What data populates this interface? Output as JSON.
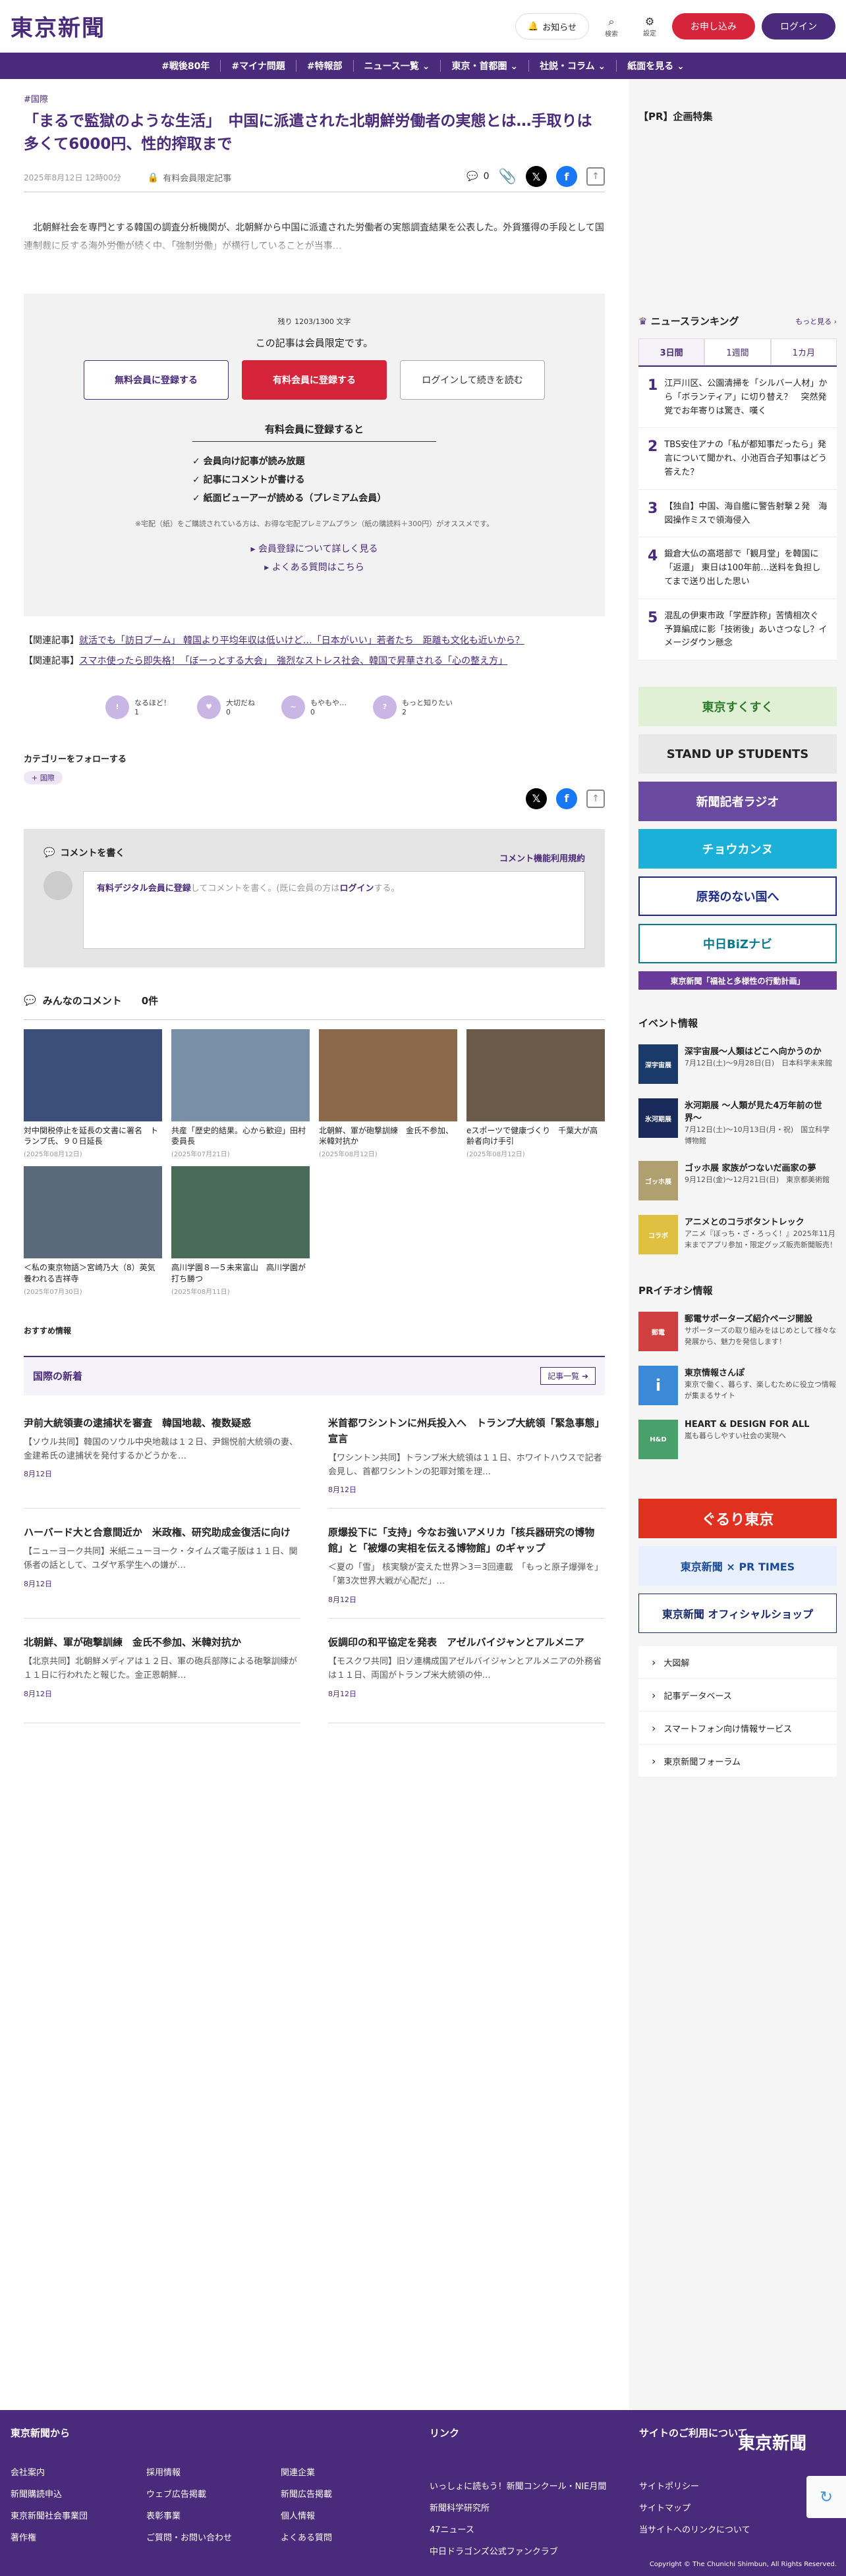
{
  "header": {
    "logo": "東京新聞",
    "notify": "お知らせ",
    "search": "検索",
    "settings": "設定",
    "apply": "お申し込み",
    "login": "ログイン"
  },
  "nav": [
    "#戦後80年",
    "#マイナ問題",
    "#特報部",
    "ニュース一覧 ⌄",
    "東京・首都圏 ⌄",
    "社説・コラム ⌄",
    "紙面を見る ⌄"
  ],
  "article": {
    "category": "#国際",
    "title": "「まるで監獄のような生活」　中国に派遣された北朝鮮労働者の実態とは…手取りは多くて6000円、性的搾取まで",
    "date": "2025年8月12日 12時00分",
    "members_only": "有料会員限定記事",
    "comment_count": "0",
    "lead": "　北朝鮮社会を専門とする韓国の調査分析機関が、北朝鮮から中国に派遣された労働者の実態調査結果を公表した。外貨獲得の手段として国連制裁に反する海外労働が続く中、「強制労働」が横行していることが当事…"
  },
  "paywall": {
    "remaining": "残り 1203/1300 文字",
    "members_only": "この記事は会員限定です。",
    "free_btn": "無料会員に登録する",
    "paid_btn": "有料会員に登録する",
    "login_btn": "ログインして続きを読む",
    "subhead": "有料会員に登録すると",
    "benefits": [
      "会員向け記事が読み放題",
      "記事にコメントが書ける",
      "紙面ビューアーが読める（プレミアム会員）"
    ],
    "note": "※宅配（紙）をご購読されている方は、お得な宅配プレミアムプラン（紙の購読料＋300円）がオススメです。",
    "link1": "会員登録について詳しく見る",
    "link2": "よくある質問はこちら"
  },
  "related": [
    {
      "prefix": "【関連記事】",
      "text": "就活でも「訪日ブーム」 韓国より平均年収は低いけど…「日本がいい」若者たち　距離も文化も近いから？"
    },
    {
      "prefix": "【関連記事】",
      "text": "スマホ使ったら即失格！「ぼーっとする大会」　強烈なストレス社会、韓国で昇華される「心の整え方」"
    }
  ],
  "reactions": [
    {
      "icon": "!",
      "label": "なるほど！",
      "count": "1",
      "color": "#c9b6e4"
    },
    {
      "icon": "♥",
      "label": "大切だね",
      "count": "0",
      "color": "#c9b6e4"
    },
    {
      "icon": "~",
      "label": "もやもや…",
      "count": "0",
      "color": "#c9b6e4"
    },
    {
      "icon": "?",
      "label": "もっと知りたい",
      "count": "2",
      "color": "#c9b6e4"
    }
  ],
  "follow": {
    "title": "カテゴリーをフォローする",
    "chip": "国際"
  },
  "comment_box": {
    "title": "コメントを書く",
    "rules": "コメント機能利用規約",
    "prompt_link": "有料デジタル会員に登録",
    "prompt_mid": "してコメントを書く。(既に会員の方は",
    "prompt_login": "ログイン",
    "prompt_end": "する。"
  },
  "all_comments": {
    "title": "みんなのコメント",
    "count": "0件"
  },
  "photos": [
    {
      "caption": "対中関税停止を延長の文書に署名　トランプ氏、９０日延長",
      "date": "(2025年08月12日)",
      "color": "#3b4f7a"
    },
    {
      "caption": "共産「歴史的結果。心から歓迎」田村委員長",
      "date": "(2025年07月21日)",
      "color": "#7a8fa8"
    },
    {
      "caption": "北朝鮮、軍が砲撃訓練　金氏不参加、米韓対抗か",
      "date": "(2025年08月12日)",
      "color": "#8a6a4a"
    },
    {
      "caption": "eスポーツで健康づくり　千葉大が高齢者向け手引",
      "date": "(2025年08月12日)",
      "color": "#6a5a4a"
    },
    {
      "caption": "＜私の東京物語＞宮崎乃大（8）英気養われる吉祥寺",
      "date": "(2025年07月30日)",
      "color": "#5a6a7a"
    },
    {
      "caption": "高川学園８―５未来富山　高川学園が打ち勝つ",
      "date": "(2025年08月11日)",
      "color": "#4a6a5a"
    }
  ],
  "recommend": "おすすめ情報",
  "intl": {
    "title": "国際の新着",
    "more": "記事一覧 ➔",
    "items": [
      {
        "title": "尹前大統領妻の逮捕状を審査　韓国地裁、複数疑惑",
        "body": "【ソウル共同】韓国のソウル中央地裁は１２日、尹錫悦前大統領の妻、金建希氏の逮捕状を発付するかどうかを…",
        "date": "8月12日"
      },
      {
        "title": "米首都ワシントンに州兵投入へ　トランプ大統領「緊急事態」宣言",
        "body": "【ワシントン共同】トランプ米大統領は１１日、ホワイトハウスで記者会見し、首都ワシントンの犯罪対策を理…",
        "date": "8月12日"
      },
      {
        "title": "ハーバード大と合意間近か　米政権、研究助成金復活に向け",
        "body": "【ニューヨーク共同】米紙ニューヨーク・タイムズ電子版は１１日、関係者の話として、ユダヤ系学生への嫌が…",
        "date": "8月12日"
      },
      {
        "title": "原爆投下に「支持」今なお強いアメリカ「核兵器研究の博物館」と「被爆の実相を伝える博物館」のギャップ",
        "body": "＜夏の「雪」 核実験が変えた世界＞3＝3回連載　「もっと原子爆弾を」「第3次世界大戦が心配だ」…",
        "date": "8月12日"
      },
      {
        "title": "北朝鮮、軍が砲撃訓練　金氏不参加、米韓対抗か",
        "body": "【北京共同】北朝鮮メディアは１２日、軍の砲兵部隊による砲撃訓練が１１日に行われたと報じた。金正恩朝鮮…",
        "date": "8月12日"
      },
      {
        "title": "仮調印の和平協定を発表　アゼルバイジャンとアルメニア",
        "body": "【モスクワ共同】旧ソ連構成国アゼルバイジャンとアルメニアの外務省は１１日、両国がトランプ米大統領の仲…",
        "date": "8月12日"
      }
    ]
  },
  "sidebar": {
    "pr_title": "【PR】企画特集",
    "ranking_title": "ニュースランキング",
    "ranking_more": "もっと見る ›",
    "tabs": [
      "3日間",
      "1週間",
      "1カ月"
    ],
    "ranking": [
      {
        "num": "1",
        "text": "江戸川区、公園清掃を「シルバー人材」から「ボランティア」に切り替え？　突然発覚でお年寄りは驚き、嘆く"
      },
      {
        "num": "2",
        "text": "TBS安住アナの「私が都知事だったら」発言について聞かれ、小池百合子知事はどう答えた？"
      },
      {
        "num": "3",
        "text": "【独自】中国、海自艦に警告射撃２発　海図操作ミスで領海侵入"
      },
      {
        "num": "4",
        "text": "鍛倉大仏の高塔部で「観月堂」を韓国に「返還」 東日は100年前…送料を負担してまで送り出した思い"
      },
      {
        "num": "5",
        "text": "混乱の伊東市政「学歴詐称」苦情相次ぐ　予算編成に影「技術後」あいさつなし？イメージダウン懸念"
      }
    ],
    "banners": [
      {
        "label": "東京すくすく",
        "bg": "#dff0d4",
        "fg": "#2a7a2a"
      },
      {
        "label": "STAND UP STUDENTS",
        "bg": "#e8e8e8",
        "fg": "#222"
      },
      {
        "label": "新聞記者ラジオ",
        "bg": "#6a4aa0",
        "fg": "#fff"
      },
      {
        "label": "チョウカンヌ",
        "bg": "#1ab0d8",
        "fg": "#fff"
      },
      {
        "label": "原発のない国へ",
        "bg": "#fff",
        "fg": "#1a2a8a"
      },
      {
        "label": "中日BiZナビ",
        "bg": "#fff",
        "fg": "#0a7a8a"
      },
      {
        "label": "東京新聞「福祉と多様性の行動計画」",
        "bg": "#6a3a9a",
        "fg": "#fff"
      }
    ],
    "events_title": "イベント情報",
    "events": [
      {
        "title": "深宇宙展〜人類はどこへ向かうのか",
        "desc": "7月12日(土)〜9月28日(日)　日本科学未来館",
        "thumb": "深宇宙展",
        "bg": "#1a3a6a"
      },
      {
        "title": "氷河期展 〜人類が見た4万年前の世界〜",
        "desc": "7月12日(土)〜10月13日(月・祝)　国立科学博物館",
        "thumb": "氷河期展",
        "bg": "#1a2a5a"
      },
      {
        "title": "ゴッホ展 家族がつないだ画家の夢",
        "desc": "9月12日(金)〜12月21日(日)　東京都美術館",
        "thumb": "ゴッホ展",
        "bg": "#b0a070"
      },
      {
        "title": "アニメとのコラボタントレック",
        "desc": "アニメ『ぼっち・ざ・ろっく！』2025年11月末までアプリ参加・限定グッズ販売新聞販売！",
        "thumb": "コラボ",
        "bg": "#e0c040"
      }
    ],
    "prichi_title": "PRイチオシ情報",
    "prichi": [
      {
        "title": "郵電サポーターズ紹介ページ開設",
        "desc": "サポーターズの取り組みをはじめとして様々な発展から、魅力を発信します！",
        "thumb": "郵電",
        "bg": "#d04040"
      },
      {
        "title": "東京情報さんぽ",
        "desc": "東京で働く、暮らす、楽しむために役立つ情報が集まるサイト",
        "thumb": "i",
        "bg": "#3a8ad8"
      },
      {
        "title": "HEART & DESIGN FOR ALL",
        "desc": "嵐も暮らしやすい社会の実現へ",
        "thumb": "H&D",
        "bg": "#4aa06a"
      }
    ],
    "bottom_banners": [
      {
        "label": "ぐるり東京",
        "bg": "#e03020",
        "fg": "#fff"
      },
      {
        "label": "東京新聞 × PR TIMES",
        "bg": "#e8f0ff",
        "fg": "#1a4a9a"
      },
      {
        "label": "東京新聞 オフィシャルショップ",
        "bg": "#fff",
        "fg": "#1a2a6a"
      }
    ],
    "links": [
      "大図解",
      "記事データベース",
      "スマートフォン向け情報サービス",
      "東京新聞フォーラム"
    ]
  },
  "footer": {
    "col1_title": "東京新聞から",
    "col1a": [
      "会社案内",
      "新聞購読申込",
      "東京新聞社会事業団",
      "著作権"
    ],
    "col1b": [
      "採用情報",
      "ウェブ広告掲載",
      "表彰事業",
      "ご質問・お問い合わせ"
    ],
    "col1c": [
      "関連企業",
      "新聞広告掲載",
      "個人情報",
      "よくある質問"
    ],
    "col2_title": "リンク",
    "col2": [
      "いっしょに読もう！新聞コンクール・NIE月間",
      "新聞科学研究所",
      "47ニュース",
      "中日ドラゴンズ公式ファンクラブ"
    ],
    "col3_title": "サイトのご利用について",
    "col3": [
      "サイトポリシー",
      "サイトマップ",
      "当サイトへのリンクについて"
    ],
    "logo": "東京新聞",
    "copyright": "Copyright © The Chunichi Shimbun, All Rights Reserved."
  }
}
